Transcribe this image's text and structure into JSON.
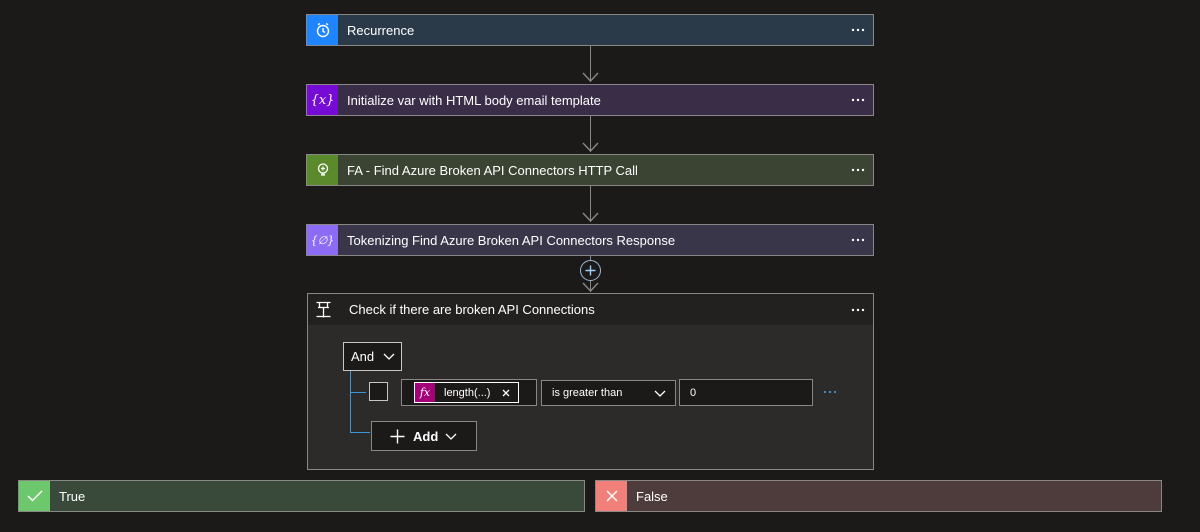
{
  "steps": [
    {
      "label": "Recurrence",
      "icon": "alarm-clock-icon",
      "color": "#1f85ff",
      "bg": "#2b3a49"
    },
    {
      "label": "Initialize var with HTML body email template",
      "icon": "variable-icon",
      "color": "#770bd6",
      "bg": "#3a2d48"
    },
    {
      "label": "FA - Find Azure Broken API Connectors HTTP Call",
      "icon": "function-app-icon",
      "color": "#5a8a2c",
      "bg": "#3b4432"
    },
    {
      "label": "Tokenizing Find Azure Broken API Connectors Response",
      "icon": "parse-json-icon",
      "color": "#8c6cf4",
      "bg": "#3a3649"
    }
  ],
  "condition": {
    "title": "Check if there are broken API Connections",
    "group_operator": "And",
    "token_label": "length(...)",
    "operator": "is greater than",
    "value": "0",
    "add_label": "Add"
  },
  "branches": {
    "true_label": "True",
    "false_label": "False",
    "true_color": "#6dc76d",
    "false_color": "#f1807b"
  },
  "more_glyph": "···"
}
